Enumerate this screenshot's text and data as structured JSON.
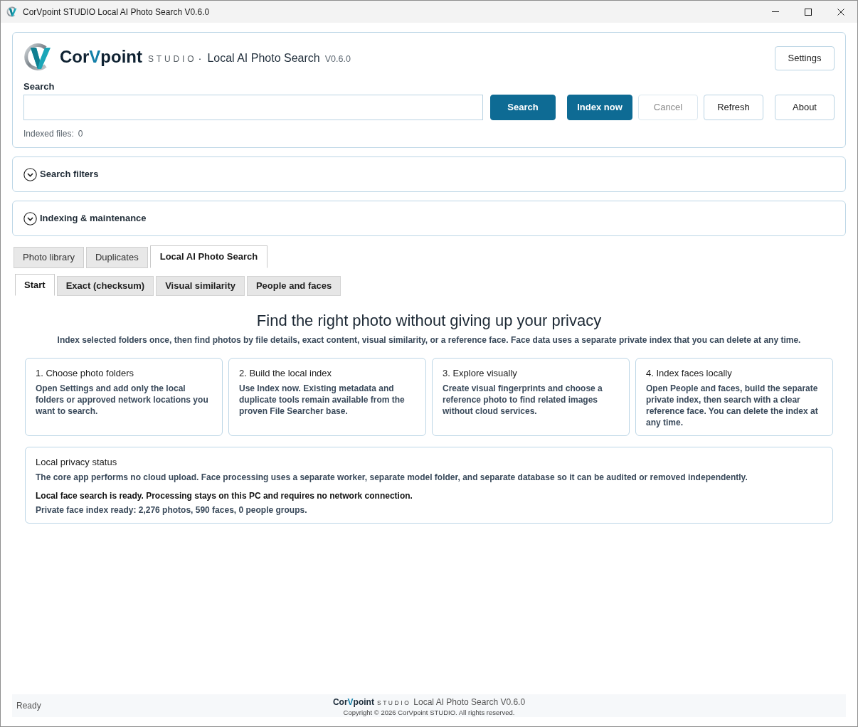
{
  "window": {
    "title": "CorVpoint STUDIO Local AI Photo Search V0.6.0"
  },
  "header": {
    "brand": {
      "name_start": "Cor",
      "name_accent": "V",
      "name_end": "point",
      "studio": "STUDIO",
      "separator": "·",
      "product": "Local AI Photo Search",
      "version": "V0.6.0"
    },
    "settings_button": "Settings",
    "search_label": "Search",
    "buttons": [
      {
        "label": "Search",
        "kind": "primary",
        "disabled": false
      },
      {
        "label": "Index now",
        "kind": "primary",
        "disabled": false
      },
      {
        "label": "Cancel",
        "kind": "secondary",
        "disabled": true
      },
      {
        "label": "Refresh",
        "kind": "secondary",
        "disabled": false
      },
      {
        "label": "About",
        "kind": "secondary",
        "disabled": false
      }
    ],
    "indexed_files": {
      "label": "Indexed files:",
      "value": "0"
    }
  },
  "sections": [
    {
      "title": "Search filters",
      "expanded": false
    },
    {
      "title": "Indexing & maintenance",
      "expanded": false
    }
  ],
  "tabs": [
    {
      "label": "Photo library",
      "selected": false
    },
    {
      "label": "Duplicates",
      "selected": false
    },
    {
      "label": "Local AI Photo Search",
      "selected": true
    }
  ],
  "subtabs": [
    {
      "label": "Start",
      "selected": true
    },
    {
      "label": "Exact (checksum)",
      "selected": false
    },
    {
      "label": "Visual similarity",
      "selected": false
    },
    {
      "label": "People and faces",
      "selected": false
    }
  ],
  "start_page": {
    "heading": "Find the right photo without giving up your privacy",
    "subtitle": "Index selected folders once, then find photos by file details, exact content, visual similarity, or a reference face. Face data uses a separate private index that you can delete at any time.",
    "steps": [
      {
        "title": "1. Choose photo folders",
        "body": "Open Settings and add only the local folders or approved network locations you want to search."
      },
      {
        "title": "2. Build the local index",
        "body": "Use Index now. Existing metadata and duplicate tools remain available from the proven File Searcher base."
      },
      {
        "title": "3. Explore visually",
        "body": "Create visual fingerprints and choose a reference photo to find related images without cloud services."
      },
      {
        "title": "4. Index faces locally",
        "body": "Open People and faces, build the separate private index, then search with a clear reference face. You can delete the index at any time."
      }
    ],
    "privacy": {
      "title": "Local privacy status",
      "body": "The core app performs no cloud upload. Face processing uses a separate worker, separate model folder, and separate database so it can be audited or removed independently.",
      "status": "Local face search is ready. Processing stays on this PC and requires no network connection.",
      "stats": "Private face index ready: 2,276 photos, 590 faces, 0 people groups."
    }
  },
  "status_bar": {
    "text": "Ready",
    "footer": {
      "name_start": "Cor",
      "name_accent": "V",
      "name_end": "point",
      "studio": "STUDIO",
      "product": "Local AI Photo Search V0.6.0",
      "copyright": "Copyright © 2026 CorVpoint STUDIO. All rights reserved."
    }
  }
}
